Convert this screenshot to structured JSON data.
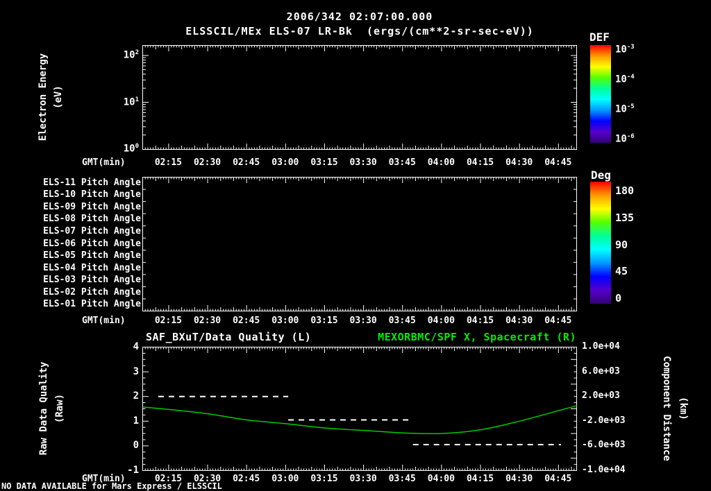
{
  "header": {
    "timestamp": "2006/342 02:07:00.000",
    "title": "ELSSCIL/MEx ELS-07 LR-Bk  (ergs/(cm**2-sr-sec-eV))"
  },
  "colors": {
    "background": "#000000",
    "foreground": "#ffffff",
    "accent_green_title": "#00ee00",
    "curve_green": "#00cc00",
    "quality_white": "#ffffff",
    "colorbar_gradient": [
      "#ff0000",
      "#ff9900",
      "#ffff00",
      "#55ff00",
      "#00ff99",
      "#00ffff",
      "#0099ff",
      "#0000ff",
      "#5500cc",
      "#330077"
    ]
  },
  "x_axis": {
    "label": "GMT(min)",
    "tick_labels": [
      "02:15",
      "02:30",
      "02:45",
      "03:00",
      "03:15",
      "03:30",
      "03:45",
      "04:00",
      "04:15",
      "04:30",
      "04:45"
    ]
  },
  "colorbar_def": {
    "label": "DEF",
    "ticks": [
      {
        "base": "10",
        "exp": "-3"
      },
      {
        "base": "10",
        "exp": "-4"
      },
      {
        "base": "10",
        "exp": "-5"
      },
      {
        "base": "10",
        "exp": "-6"
      }
    ]
  },
  "colorbar_deg": {
    "label": "Deg",
    "ticks": [
      "180",
      "135",
      "90",
      "45",
      "0"
    ]
  },
  "panel_energy": {
    "ylabel_line1": "Electron Energy",
    "ylabel_line2": "(eV)",
    "yticks": [
      {
        "base": "10",
        "exp": "2"
      },
      {
        "base": "10",
        "exp": "1"
      },
      {
        "base": "10",
        "exp": "0"
      }
    ]
  },
  "panel_pitch": {
    "row_labels": [
      "ELS-11 Pitch Angle",
      "ELS-10 Pitch Angle",
      "ELS-09 Pitch Angle",
      "ELS-08 Pitch Angle",
      "ELS-07 Pitch Angle",
      "ELS-06 Pitch Angle",
      "ELS-05 Pitch Angle",
      "ELS-04 Pitch Angle",
      "ELS-03 Pitch Angle",
      "ELS-02 Pitch Angle",
      "ELS-01 Pitch Angle"
    ]
  },
  "panel_bottom": {
    "title_left": "SAF_BXuT/Data Quality (L)",
    "title_right": "MEXORBMC/SPF X, Spacecraft (R)",
    "ylabel_left_line1": "Raw Data Quality",
    "ylabel_left_line2": "(Raw)",
    "ylabel_right_line1": "Component Distance",
    "ylabel_right_line2": "(km)",
    "yticks_left": [
      "4",
      "3",
      "2",
      "1",
      "0",
      "-1"
    ],
    "yticks_right": [
      "1.0e+04",
      "6.0e+03",
      "2.0e+03",
      "-2.0e+03",
      "-6.0e+03",
      "-1.0e+04"
    ]
  },
  "status": "NO DATA AVAILABLE for Mars Express / ELSSCIL",
  "chart_data": [
    {
      "type": "heatmap",
      "title": "ELSSCIL/MEx ELS-07 LR-Bk",
      "units": "ergs/(cm**2-sr-sec-eV)",
      "xlabel": "GMT(min)",
      "x_ticks": [
        "02:15",
        "02:30",
        "02:45",
        "03:00",
        "03:15",
        "03:30",
        "03:45",
        "04:00",
        "04:15",
        "04:30",
        "04:45"
      ],
      "x_range_minutes": [
        125,
        292
      ],
      "ylabel": "Electron Energy (eV)",
      "yscale": "log",
      "ytick_values": [
        1,
        10,
        100
      ],
      "colorbar": {
        "label": "DEF",
        "scale": "log",
        "tick_values": [
          0.001,
          0.0001,
          1e-05,
          1e-06
        ]
      },
      "values": [],
      "no_data": true
    },
    {
      "type": "heatmap",
      "rows": [
        "ELS-11 Pitch Angle",
        "ELS-10 Pitch Angle",
        "ELS-09 Pitch Angle",
        "ELS-08 Pitch Angle",
        "ELS-07 Pitch Angle",
        "ELS-06 Pitch Angle",
        "ELS-05 Pitch Angle",
        "ELS-04 Pitch Angle",
        "ELS-03 Pitch Angle",
        "ELS-02 Pitch Angle",
        "ELS-01 Pitch Angle"
      ],
      "xlabel": "GMT(min)",
      "x_ticks": [
        "02:15",
        "02:30",
        "02:45",
        "03:00",
        "03:15",
        "03:30",
        "03:45",
        "04:00",
        "04:15",
        "04:30",
        "04:45"
      ],
      "x_range_minutes": [
        125,
        292
      ],
      "colorbar": {
        "label": "Deg",
        "tick_values": [
          180,
          135,
          90,
          45,
          0
        ],
        "range": [
          0,
          180
        ]
      },
      "values": [],
      "no_data": true
    },
    {
      "type": "line",
      "title_left": "SAF_BXuT/Data Quality (L)",
      "title_right": "MEXORBMC/SPF X, Spacecraft (R)",
      "xlabel": "GMT(min)",
      "x_ticks": [
        "02:15",
        "02:30",
        "02:45",
        "03:00",
        "03:15",
        "03:30",
        "03:45",
        "04:00",
        "04:15",
        "04:30",
        "04:45"
      ],
      "x_range_minutes": [
        125,
        292
      ],
      "ylim_left": [
        -1,
        4
      ],
      "ylabel_left": "Raw Data Quality (Raw)",
      "ylim_right": [
        -10000,
        10000
      ],
      "ylabel_right": "Component Distance (km)",
      "series": [
        {
          "name": "Data Quality (L)",
          "axis": "left",
          "style": "dashed",
          "color": "#ffffff",
          "segments": [
            {
              "start": "02:11",
              "end": "03:01",
              "start_min": 131,
              "end_min": 181,
              "value": 2.0
            },
            {
              "start": "03:01",
              "end": "03:49",
              "start_min": 181,
              "end_min": 229,
              "value": 1.05
            },
            {
              "start": "03:49",
              "end": "04:46",
              "start_min": 229,
              "end_min": 286,
              "value": 0.05
            }
          ]
        },
        {
          "name": "MEXORBMC/SPF X, Spacecraft (R)",
          "axis": "right",
          "style": "solid",
          "units": "km",
          "color": "#00cc00",
          "points_min": [
            125,
            135,
            150,
            165,
            180,
            195,
            210,
            225,
            240,
            255,
            270,
            285,
            292
          ],
          "points_km": [
            300,
            -100,
            -800,
            -1800,
            -2400,
            -3100,
            -3500,
            -3900,
            -4000,
            -3400,
            -2000,
            -300,
            500
          ]
        }
      ]
    }
  ]
}
